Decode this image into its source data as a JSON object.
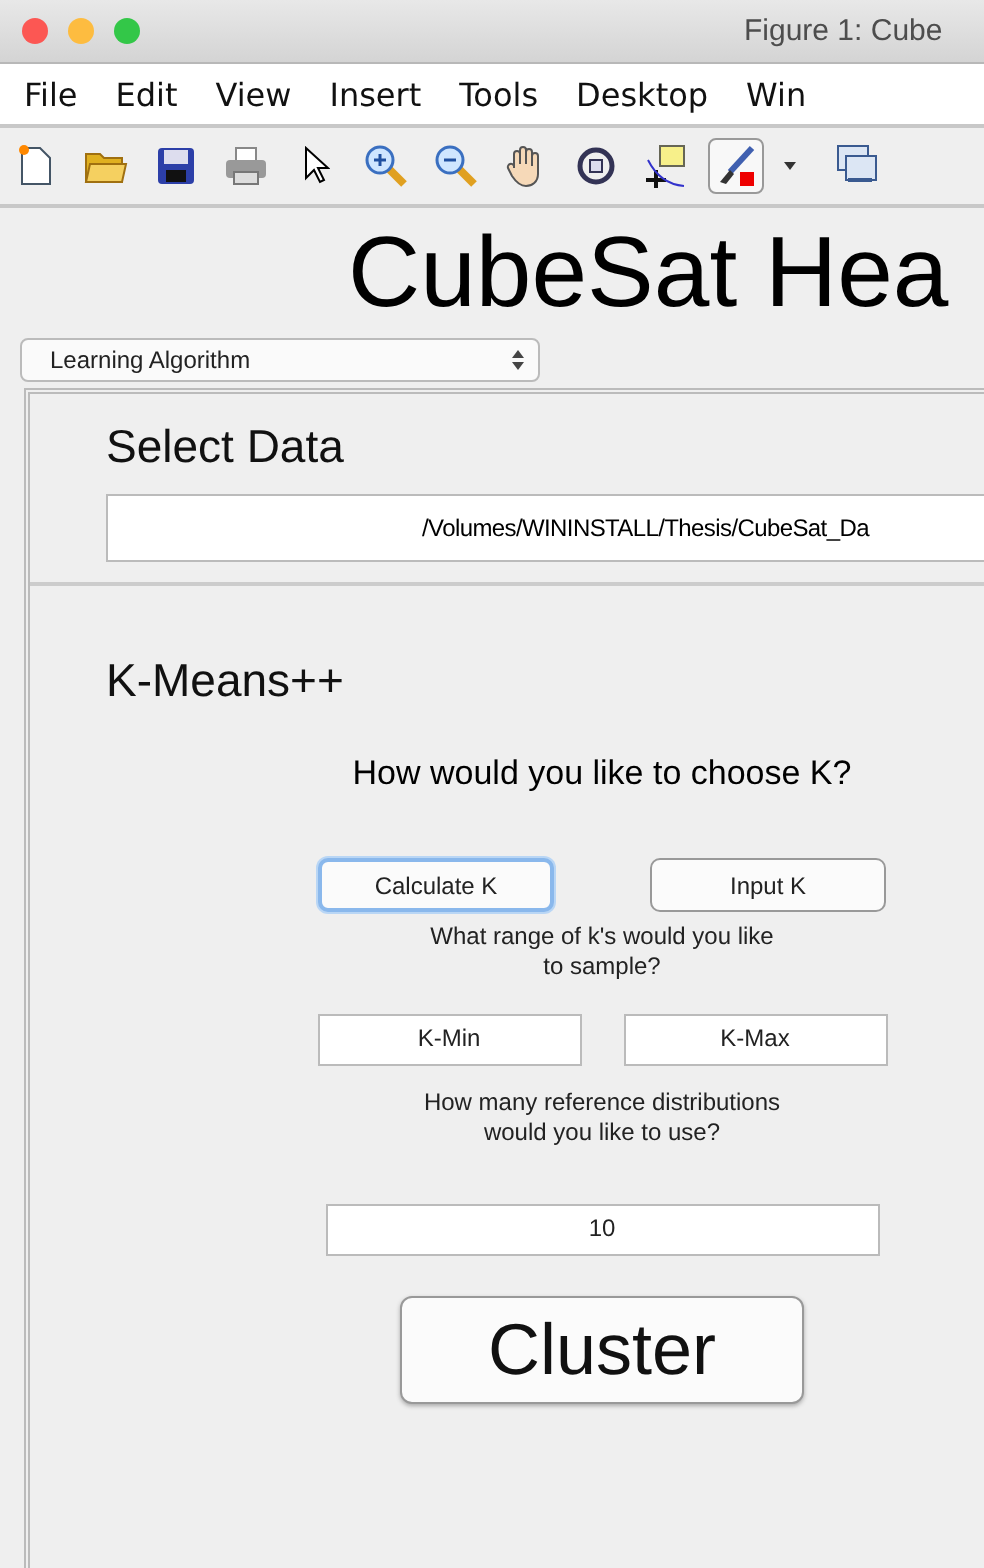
{
  "window": {
    "title": "Figure 1: Cube"
  },
  "menu": [
    "File",
    "Edit",
    "View",
    "Insert",
    "Tools",
    "Desktop",
    "Win"
  ],
  "toolbar": [
    {
      "kind": "new",
      "pressed": false
    },
    {
      "kind": "open",
      "pressed": false
    },
    {
      "kind": "save",
      "pressed": false
    },
    {
      "kind": "print",
      "pressed": false
    },
    {
      "kind": "pointer",
      "pressed": false
    },
    {
      "kind": "zoom-in",
      "pressed": false
    },
    {
      "kind": "zoom-out",
      "pressed": false
    },
    {
      "kind": "pan",
      "pressed": false
    },
    {
      "kind": "rotate",
      "pressed": false
    },
    {
      "kind": "cursor",
      "pressed": false
    },
    {
      "kind": "brush",
      "pressed": true
    },
    {
      "kind": "dropdown",
      "pressed": false
    },
    {
      "kind": "link",
      "pressed": false
    }
  ],
  "heading": "CubeSat Hea",
  "algorithm_select": {
    "value": "Learning Algorithm"
  },
  "select_data": {
    "title": "Select Data",
    "path": "/Volumes/WININSTALL/Thesis/CubeSat_Da"
  },
  "kmeans": {
    "title": "K-Means++",
    "question": "How would you like to choose K?",
    "choose_buttons": [
      {
        "label": "Calculate K",
        "selected": true
      },
      {
        "label": "Input K",
        "selected": false
      }
    ],
    "range_prompt": [
      "What range of k's would you like",
      "to sample?"
    ],
    "k_min": "K-Min",
    "k_max": "K-Max",
    "ref_prompt": [
      "How many reference distributions",
      "would you like to use?"
    ],
    "ref_count": "10",
    "cluster_button": "Cluster"
  }
}
